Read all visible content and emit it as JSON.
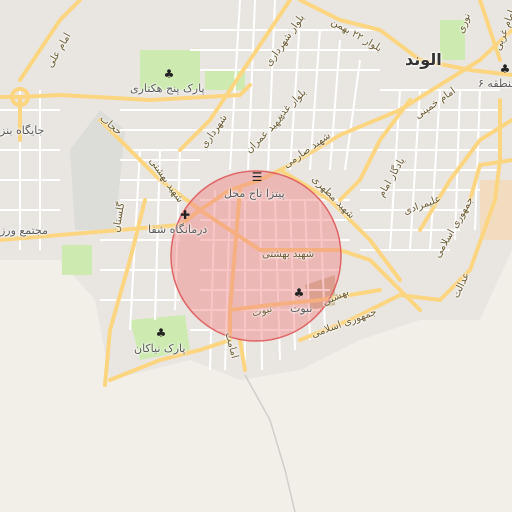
{
  "map": {
    "city": "الوند",
    "places": {
      "park_5ha": "پارک پنج هکتاری",
      "park_niakan": "پارک نیاکان",
      "pizza": "پیتزا تاج محل",
      "clinic": "درمانگاه شفا",
      "nabout": "نبوت",
      "jaygah": "جایگاه بنز",
      "majtama": "مجتمع ورز",
      "district6": "منطقه ۶"
    },
    "roads": {
      "imam_ali": "امام علی",
      "shahrdari_blvd": "بلوار شهرداری",
      "bahman22_blvd": "بلوار ۲۲ بهمن",
      "bolvar_ghadir": "بلوار غدیر",
      "shahrdari": "شهرداری",
      "shahid_imran": "شهید عمران",
      "shahid_sarami": "شهید صارمی",
      "shahid_beheshti_w": "شهید بهشتی",
      "shahid_beheshti": "شهید بهشتی",
      "beheshti_short": "بهشتی",
      "shahid_motahari": "شهید مطهری",
      "imam_khomeini": "امام خمینی",
      "alimardani": "علیمرادی",
      "yadegar_imam": "یادگار امام",
      "jomhuri_n": "جمهوری اسلامی",
      "jomhuri_s": "جمهوری اسلامی",
      "golestan": "گلستان",
      "nabout_road": "نبوت",
      "emamat": "امامت",
      "hojab": "حجاب",
      "edalat": "عدالت",
      "nouri": "نوری",
      "imam_ghorbi": "امام غربی"
    },
    "icons": {
      "park": "tree-icon",
      "restaurant": "burger-icon",
      "hospital": "cross-icon",
      "marker": "tree-icon"
    },
    "colors": {
      "background": "#f2efe9",
      "road_major": "#fcd581",
      "road_minor": "#ffffff",
      "park": "#cdebb0",
      "circle_fill": "#f08080",
      "circle_stroke": "#e06666"
    }
  }
}
